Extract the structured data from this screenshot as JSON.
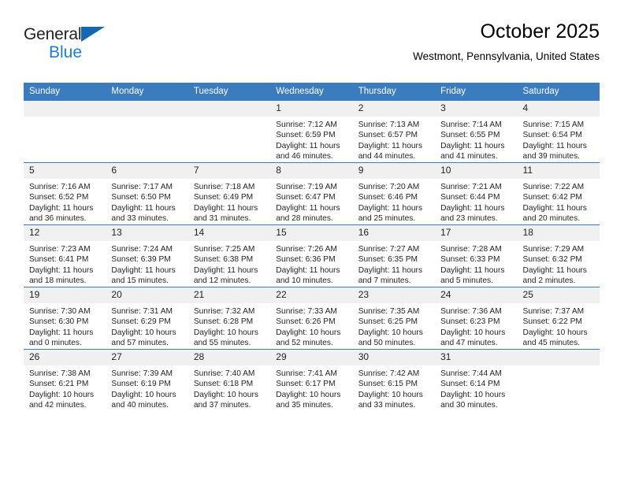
{
  "brand": {
    "name_top": "General",
    "name_bottom": "Blue",
    "triangle_icon": "blue-triangle-icon",
    "accent_color": "#1268b3",
    "blue_text_color": "#1a7fd4"
  },
  "header": {
    "title": "October 2025",
    "subtitle": "Westmont, Pennsylvania, United States"
  },
  "theme": {
    "header_row_bg": "#3a7cbe",
    "header_row_text": "#ffffff",
    "daynum_bg": "#f0f0f0",
    "body_text": "#231f20",
    "page_bg": "#ffffff"
  },
  "weekdays": [
    "Sunday",
    "Monday",
    "Tuesday",
    "Wednesday",
    "Thursday",
    "Friday",
    "Saturday"
  ],
  "labels": {
    "sunrise_prefix": "Sunrise:",
    "sunset_prefix": "Sunset:",
    "daylight_prefix": "Daylight:"
  },
  "weeks": [
    [
      {
        "day": "",
        "empty": true
      },
      {
        "day": "",
        "empty": true
      },
      {
        "day": "",
        "empty": true
      },
      {
        "day": "1",
        "sunrise": "Sunrise: 7:12 AM",
        "sunset": "Sunset: 6:59 PM",
        "daylight": "Daylight: 11 hours and 46 minutes."
      },
      {
        "day": "2",
        "sunrise": "Sunrise: 7:13 AM",
        "sunset": "Sunset: 6:57 PM",
        "daylight": "Daylight: 11 hours and 44 minutes."
      },
      {
        "day": "3",
        "sunrise": "Sunrise: 7:14 AM",
        "sunset": "Sunset: 6:55 PM",
        "daylight": "Daylight: 11 hours and 41 minutes."
      },
      {
        "day": "4",
        "sunrise": "Sunrise: 7:15 AM",
        "sunset": "Sunset: 6:54 PM",
        "daylight": "Daylight: 11 hours and 39 minutes."
      }
    ],
    [
      {
        "day": "5",
        "sunrise": "Sunrise: 7:16 AM",
        "sunset": "Sunset: 6:52 PM",
        "daylight": "Daylight: 11 hours and 36 minutes."
      },
      {
        "day": "6",
        "sunrise": "Sunrise: 7:17 AM",
        "sunset": "Sunset: 6:50 PM",
        "daylight": "Daylight: 11 hours and 33 minutes."
      },
      {
        "day": "7",
        "sunrise": "Sunrise: 7:18 AM",
        "sunset": "Sunset: 6:49 PM",
        "daylight": "Daylight: 11 hours and 31 minutes."
      },
      {
        "day": "8",
        "sunrise": "Sunrise: 7:19 AM",
        "sunset": "Sunset: 6:47 PM",
        "daylight": "Daylight: 11 hours and 28 minutes."
      },
      {
        "day": "9",
        "sunrise": "Sunrise: 7:20 AM",
        "sunset": "Sunset: 6:46 PM",
        "daylight": "Daylight: 11 hours and 25 minutes."
      },
      {
        "day": "10",
        "sunrise": "Sunrise: 7:21 AM",
        "sunset": "Sunset: 6:44 PM",
        "daylight": "Daylight: 11 hours and 23 minutes."
      },
      {
        "day": "11",
        "sunrise": "Sunrise: 7:22 AM",
        "sunset": "Sunset: 6:42 PM",
        "daylight": "Daylight: 11 hours and 20 minutes."
      }
    ],
    [
      {
        "day": "12",
        "sunrise": "Sunrise: 7:23 AM",
        "sunset": "Sunset: 6:41 PM",
        "daylight": "Daylight: 11 hours and 18 minutes."
      },
      {
        "day": "13",
        "sunrise": "Sunrise: 7:24 AM",
        "sunset": "Sunset: 6:39 PM",
        "daylight": "Daylight: 11 hours and 15 minutes."
      },
      {
        "day": "14",
        "sunrise": "Sunrise: 7:25 AM",
        "sunset": "Sunset: 6:38 PM",
        "daylight": "Daylight: 11 hours and 12 minutes."
      },
      {
        "day": "15",
        "sunrise": "Sunrise: 7:26 AM",
        "sunset": "Sunset: 6:36 PM",
        "daylight": "Daylight: 11 hours and 10 minutes."
      },
      {
        "day": "16",
        "sunrise": "Sunrise: 7:27 AM",
        "sunset": "Sunset: 6:35 PM",
        "daylight": "Daylight: 11 hours and 7 minutes."
      },
      {
        "day": "17",
        "sunrise": "Sunrise: 7:28 AM",
        "sunset": "Sunset: 6:33 PM",
        "daylight": "Daylight: 11 hours and 5 minutes."
      },
      {
        "day": "18",
        "sunrise": "Sunrise: 7:29 AM",
        "sunset": "Sunset: 6:32 PM",
        "daylight": "Daylight: 11 hours and 2 minutes."
      }
    ],
    [
      {
        "day": "19",
        "sunrise": "Sunrise: 7:30 AM",
        "sunset": "Sunset: 6:30 PM",
        "daylight": "Daylight: 11 hours and 0 minutes."
      },
      {
        "day": "20",
        "sunrise": "Sunrise: 7:31 AM",
        "sunset": "Sunset: 6:29 PM",
        "daylight": "Daylight: 10 hours and 57 minutes."
      },
      {
        "day": "21",
        "sunrise": "Sunrise: 7:32 AM",
        "sunset": "Sunset: 6:28 PM",
        "daylight": "Daylight: 10 hours and 55 minutes."
      },
      {
        "day": "22",
        "sunrise": "Sunrise: 7:33 AM",
        "sunset": "Sunset: 6:26 PM",
        "daylight": "Daylight: 10 hours and 52 minutes."
      },
      {
        "day": "23",
        "sunrise": "Sunrise: 7:35 AM",
        "sunset": "Sunset: 6:25 PM",
        "daylight": "Daylight: 10 hours and 50 minutes."
      },
      {
        "day": "24",
        "sunrise": "Sunrise: 7:36 AM",
        "sunset": "Sunset: 6:23 PM",
        "daylight": "Daylight: 10 hours and 47 minutes."
      },
      {
        "day": "25",
        "sunrise": "Sunrise: 7:37 AM",
        "sunset": "Sunset: 6:22 PM",
        "daylight": "Daylight: 10 hours and 45 minutes."
      }
    ],
    [
      {
        "day": "26",
        "sunrise": "Sunrise: 7:38 AM",
        "sunset": "Sunset: 6:21 PM",
        "daylight": "Daylight: 10 hours and 42 minutes."
      },
      {
        "day": "27",
        "sunrise": "Sunrise: 7:39 AM",
        "sunset": "Sunset: 6:19 PM",
        "daylight": "Daylight: 10 hours and 40 minutes."
      },
      {
        "day": "28",
        "sunrise": "Sunrise: 7:40 AM",
        "sunset": "Sunset: 6:18 PM",
        "daylight": "Daylight: 10 hours and 37 minutes."
      },
      {
        "day": "29",
        "sunrise": "Sunrise: 7:41 AM",
        "sunset": "Sunset: 6:17 PM",
        "daylight": "Daylight: 10 hours and 35 minutes."
      },
      {
        "day": "30",
        "sunrise": "Sunrise: 7:42 AM",
        "sunset": "Sunset: 6:15 PM",
        "daylight": "Daylight: 10 hours and 33 minutes."
      },
      {
        "day": "31",
        "sunrise": "Sunrise: 7:44 AM",
        "sunset": "Sunset: 6:14 PM",
        "daylight": "Daylight: 10 hours and 30 minutes."
      },
      {
        "day": "",
        "empty": true
      }
    ]
  ]
}
